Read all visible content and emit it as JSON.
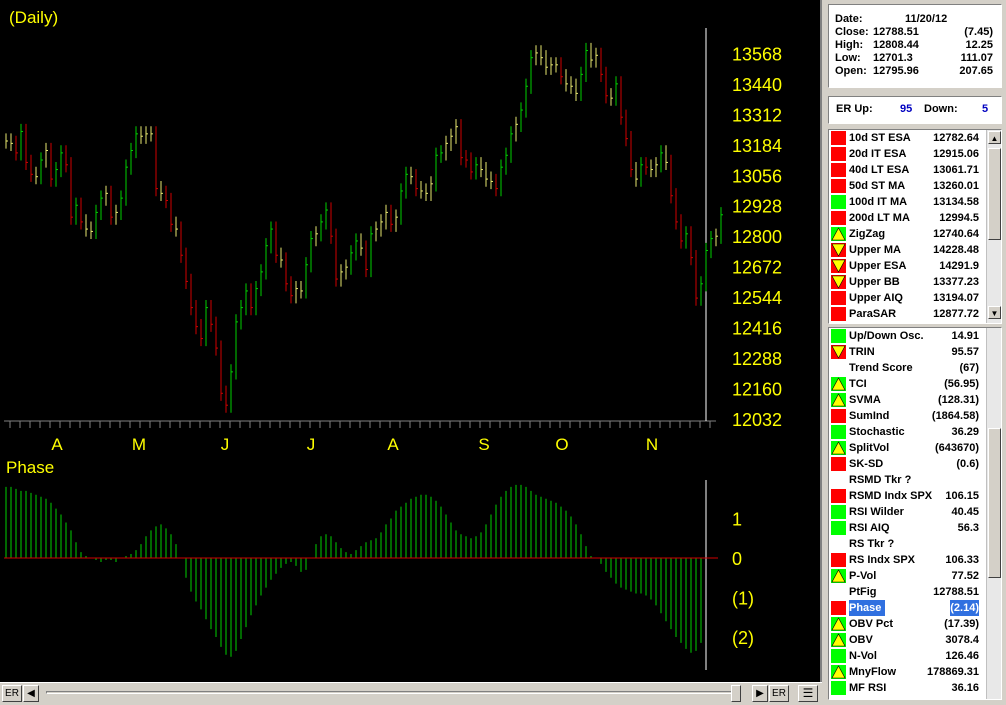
{
  "price_chart": {
    "title": "(Daily)",
    "y_ticks": [
      "13568",
      "13440",
      "13312",
      "13184",
      "13056",
      "12928",
      "12800",
      "12672",
      "12544",
      "12416",
      "12288",
      "12160",
      "12032"
    ],
    "y_tick_values": [
      13568,
      13440,
      13312,
      13184,
      13056,
      12928,
      12800,
      12672,
      12544,
      12416,
      12288,
      12160,
      12032
    ],
    "month_labels": [
      "A",
      "M",
      "J",
      "J",
      "A",
      "S",
      "O",
      "N"
    ],
    "colors": {
      "up": "#00d000",
      "down": "#d00000",
      "neutral": "#e8e870",
      "text": "#ffff00",
      "background": "#000000"
    }
  },
  "phase_chart": {
    "title": "Phase",
    "y_ticks": [
      "1",
      "0",
      "(1)",
      "(2)"
    ],
    "y_tick_values": [
      1,
      0,
      -1,
      -2
    ],
    "colors": {
      "bars": "#00d000",
      "zero_line": "#d00000"
    }
  },
  "chart_data": [
    {
      "type": "bar",
      "title": "(Daily)",
      "ylim": [
        12032,
        13620
      ],
      "closes": [
        13200,
        13190,
        13150,
        13240,
        13110,
        13060,
        13050,
        13120,
        13160,
        13040,
        13080,
        13150,
        13100,
        12880,
        12930,
        12860,
        12830,
        12820,
        12900,
        12960,
        12980,
        12880,
        12900,
        12960,
        13090,
        13160,
        13230,
        13220,
        13230,
        13230,
        13000,
        12980,
        12950,
        12850,
        12830,
        12720,
        12610,
        12500,
        12420,
        12370,
        12500,
        12430,
        12330,
        12140,
        12090,
        12230,
        12440,
        12500,
        12570,
        12500,
        12580,
        12650,
        12760,
        12830,
        12720,
        12700,
        12600,
        12550,
        12580,
        12570,
        12680,
        12790,
        12810,
        12860,
        12910,
        12800,
        12620,
        12650,
        12670,
        12730,
        12780,
        12750,
        12660,
        12810,
        12830,
        12860,
        12900,
        12850,
        12880,
        12990,
        13060,
        13050,
        13000,
        12990,
        12980,
        13020,
        13140,
        13150,
        13190,
        13220,
        13260,
        13130,
        13120,
        13070,
        13100,
        13080,
        13040,
        13030,
        13000,
        13090,
        13140,
        13230,
        13270,
        13330,
        13430,
        13550,
        13570,
        13550,
        13510,
        13520,
        13520,
        13470,
        13440,
        13430,
        13400,
        13480,
        13580,
        13540,
        13560,
        13480,
        13390,
        13380,
        13440,
        13300,
        13210,
        13080,
        13040,
        13100,
        13090,
        13080,
        13100,
        13150,
        13110,
        12970,
        12860,
        12780,
        12810,
        12710,
        12540,
        12600,
        12740,
        12790,
        12800,
        12890
      ]
    },
    {
      "type": "bar",
      "title": "Phase",
      "ylim": [
        -2.6,
        1.9
      ],
      "values": [
        1.8,
        1.8,
        1.75,
        1.7,
        1.7,
        1.65,
        1.6,
        1.55,
        1.5,
        1.4,
        1.25,
        1.1,
        0.9,
        0.7,
        0.4,
        0.15,
        0.05,
        0.0,
        -0.05,
        -0.1,
        -0.05,
        -0.05,
        -0.1,
        0.0,
        0.05,
        0.1,
        0.2,
        0.35,
        0.55,
        0.7,
        0.8,
        0.85,
        0.75,
        0.6,
        0.35,
        0.0,
        -0.5,
        -0.85,
        -1.1,
        -1.3,
        -1.55,
        -1.8,
        -2.0,
        -2.25,
        -2.45,
        -2.5,
        -2.35,
        -2.05,
        -1.75,
        -1.45,
        -1.2,
        -0.95,
        -0.75,
        -0.55,
        -0.4,
        -0.25,
        -0.15,
        -0.1,
        -0.2,
        -0.35,
        -0.3,
        0.0,
        0.35,
        0.55,
        0.6,
        0.55,
        0.4,
        0.25,
        0.15,
        0.1,
        0.2,
        0.3,
        0.4,
        0.45,
        0.5,
        0.65,
        0.85,
        1.0,
        1.2,
        1.3,
        1.4,
        1.5,
        1.55,
        1.6,
        1.6,
        1.55,
        1.45,
        1.3,
        1.1,
        0.9,
        0.7,
        0.6,
        0.55,
        0.5,
        0.55,
        0.65,
        0.85,
        1.1,
        1.35,
        1.55,
        1.7,
        1.8,
        1.85,
        1.85,
        1.8,
        1.7,
        1.6,
        1.55,
        1.5,
        1.45,
        1.4,
        1.3,
        1.2,
        1.05,
        0.85,
        0.6,
        0.3,
        0.05,
        0.0,
        -0.15,
        -0.35,
        -0.5,
        -0.65,
        -0.75,
        -0.8,
        -0.85,
        -0.9,
        -0.9,
        -0.95,
        -1.05,
        -1.2,
        -1.4,
        -1.6,
        -1.8,
        -2.0,
        -2.15,
        -2.3,
        -2.4,
        -2.35,
        -2.15
      ]
    }
  ],
  "quote": {
    "date_label": "Date:",
    "date_value": "11/20/12",
    "close_label": "Close:",
    "close_value": "12788.51",
    "close_change": "(7.45)",
    "high_label": "High:",
    "high_value": "12808.44",
    "high_change": "12.25",
    "low_label": "Low:",
    "low_value": "12701.3",
    "low_change": "111.07",
    "open_label": "Open:",
    "open_value": "12795.96",
    "open_change": "207.65"
  },
  "er": {
    "up_label": "ER Up:",
    "up_value": "95",
    "down_label": "Down:",
    "down_value": "5"
  },
  "indicators_top": [
    {
      "name": "10d ST ESA",
      "value": "12782.64",
      "status": "red"
    },
    {
      "name": "20d IT ESA",
      "value": "12915.06",
      "status": "red"
    },
    {
      "name": "40d LT ESA",
      "value": "13061.71",
      "status": "red"
    },
    {
      "name": "50d ST MA",
      "value": "13260.01",
      "status": "red"
    },
    {
      "name": "100d IT MA",
      "value": "13134.58",
      "status": "green"
    },
    {
      "name": "200d LT MA",
      "value": "12994.5",
      "status": "red"
    },
    {
      "name": "ZigZag",
      "value": "12740.64",
      "status": "up"
    },
    {
      "name": "Upper MA",
      "value": "14228.48",
      "status": "down"
    },
    {
      "name": "Upper ESA",
      "value": "14291.9",
      "status": "down"
    },
    {
      "name": "Upper BB",
      "value": "13377.23",
      "status": "down"
    },
    {
      "name": "Upper AIQ",
      "value": "13194.07",
      "status": "red"
    },
    {
      "name": "ParaSAR",
      "value": "12877.72",
      "status": "red"
    }
  ],
  "indicators_bottom": [
    {
      "name": "Up/Down Osc.",
      "value": "14.91",
      "status": "green"
    },
    {
      "name": "TRIN",
      "value": "95.57",
      "status": "down"
    },
    {
      "name": "Trend Score",
      "value": "(67)",
      "status": "none"
    },
    {
      "name": "TCI",
      "value": "(56.95)",
      "status": "up"
    },
    {
      "name": "SVMA",
      "value": "(128.31)",
      "status": "up"
    },
    {
      "name": "SumInd",
      "value": "(1864.58)",
      "status": "red"
    },
    {
      "name": "Stochastic",
      "value": "36.29",
      "status": "green"
    },
    {
      "name": "SplitVol",
      "value": "(643670)",
      "status": "up"
    },
    {
      "name": "SK-SD",
      "value": "(0.6)",
      "status": "red"
    },
    {
      "name": "RSMD Tkr ?",
      "value": "",
      "status": "none"
    },
    {
      "name": "RSMD Indx SPX",
      "value": "106.15",
      "status": "red"
    },
    {
      "name": "RSI Wilder",
      "value": "40.45",
      "status": "green"
    },
    {
      "name": "RSI AIQ",
      "value": "56.3",
      "status": "green"
    },
    {
      "name": "RS Tkr ?",
      "value": "",
      "status": "none"
    },
    {
      "name": "RS Indx SPX",
      "value": "106.33",
      "status": "red"
    },
    {
      "name": "P-Vol",
      "value": "77.52",
      "status": "up"
    },
    {
      "name": "PtFig",
      "value": "12788.51",
      "status": "none"
    },
    {
      "name": "Phase",
      "value": "(2.14)",
      "status": "red",
      "selected": true
    },
    {
      "name": "OBV Pct",
      "value": "(17.39)",
      "status": "up"
    },
    {
      "name": "OBV",
      "value": "3078.4",
      "status": "up"
    },
    {
      "name": "N-Vol",
      "value": "126.46",
      "status": "green"
    },
    {
      "name": "MnyFlow",
      "value": "178869.31",
      "status": "up"
    },
    {
      "name": "MF RSI",
      "value": "36.16",
      "status": "green"
    }
  ],
  "bottom_bar": {
    "left_button": "ER",
    "right_button": "ER"
  }
}
